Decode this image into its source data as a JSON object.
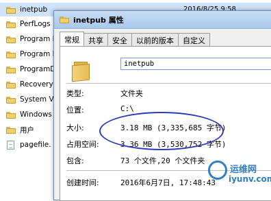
{
  "explorer": {
    "items": [
      {
        "name": "inetpub",
        "type": "folder",
        "selected": true
      },
      {
        "name": "PerfLogs",
        "type": "folder"
      },
      {
        "name": "Program F",
        "type": "folder"
      },
      {
        "name": "Program F",
        "type": "folder"
      },
      {
        "name": "ProgramDa",
        "type": "folder"
      },
      {
        "name": "Recovery",
        "type": "folder"
      },
      {
        "name": "System Vo",
        "type": "folder"
      },
      {
        "name": "Windows",
        "type": "folder"
      },
      {
        "name": "用户",
        "type": "folder"
      },
      {
        "name": "pagefile.",
        "type": "file"
      }
    ],
    "selected_date": "2016/8/25 9:58"
  },
  "dialog": {
    "title": "inetpub 属性",
    "tabs": [
      "常规",
      "共享",
      "安全",
      "以前的版本",
      "自定义"
    ],
    "active_tab": "常规",
    "folder_name": "inetpub",
    "fields": {
      "type_label": "类型:",
      "type_value": "文件夹",
      "location_label": "位置:",
      "location_value": "C:\\",
      "size_label": "大小:",
      "size_value": "3.18 MB (3,335,685 字节)",
      "disk_label": "占用空间:",
      "disk_value": "3.36 MB (3,530,752 字节)",
      "contains_label": "包含:",
      "contains_value": "73 个文件,20 个文件夹",
      "created_label": "创建时间:",
      "created_value": "2016年6月7日, 17:48:43"
    }
  },
  "watermark": {
    "cn": "运维网",
    "en": "iyunv.com"
  },
  "colors": {
    "accent": "#2b3ab8",
    "selection": "#cfe3fb",
    "watermark": "#2f7fc8"
  }
}
